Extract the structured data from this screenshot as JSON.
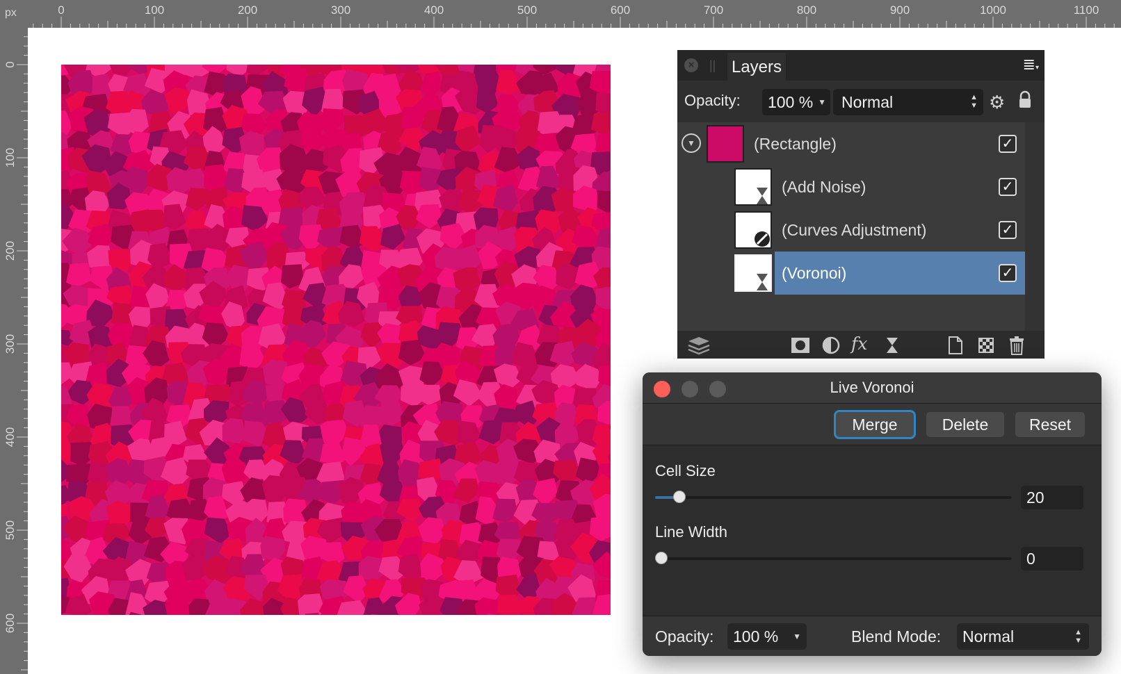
{
  "ruler": {
    "unit": "px",
    "top_labels": [
      "0",
      "100",
      "200",
      "300",
      "400",
      "500",
      "600",
      "700",
      "800",
      "900",
      "1000",
      "1100"
    ],
    "left_labels": [
      "0",
      "100",
      "200",
      "300",
      "400",
      "500",
      "600"
    ]
  },
  "canvas": {
    "artwork": "voronoi-pattern-rectangle",
    "palette": [
      "#e0005e",
      "#c70958",
      "#f2127a",
      "#a0064a",
      "#d21572",
      "#b8106a",
      "#ea0a4a",
      "#8e0c5a",
      "#f0308a",
      "#cf0a45"
    ]
  },
  "layers_panel": {
    "tab_label": "Layers",
    "opacity_label": "Opacity:",
    "opacity_value": "100 %",
    "blend_mode": "Normal",
    "layers": [
      {
        "label": "(Rectangle)",
        "checked": true,
        "selected": false
      },
      {
        "label": "(Add Noise)",
        "checked": true,
        "selected": false
      },
      {
        "label": "(Curves Adjustment)",
        "checked": true,
        "selected": false
      },
      {
        "label": "(Voronoi)",
        "checked": true,
        "selected": true
      }
    ],
    "check_glyph": "✓",
    "footer_icons": [
      "layers-icon",
      "mask-icon",
      "adjustment-icon",
      "fx-icon",
      "live-filter-icon",
      "new-layer-icon",
      "pixel-layer-icon",
      "trash-icon"
    ],
    "fx_text": "fx"
  },
  "voronoi_dialog": {
    "title": "Live Voronoi",
    "buttons": {
      "merge": "Merge",
      "delete": "Delete",
      "reset": "Reset"
    },
    "cell_size": {
      "label": "Cell Size",
      "value": "20",
      "fraction": 0.05
    },
    "line_width": {
      "label": "Line Width",
      "value": "0",
      "fraction": 0.0
    },
    "opacity_label": "Opacity:",
    "opacity_value": "100 %",
    "blend_label": "Blend Mode:",
    "blend_value": "Normal"
  },
  "colors": {
    "close_red": "#fc5f57",
    "traffic_gray": "#5a5a5a",
    "selection_blue": "#5780ae",
    "focus_ring": "#2e86c4"
  }
}
